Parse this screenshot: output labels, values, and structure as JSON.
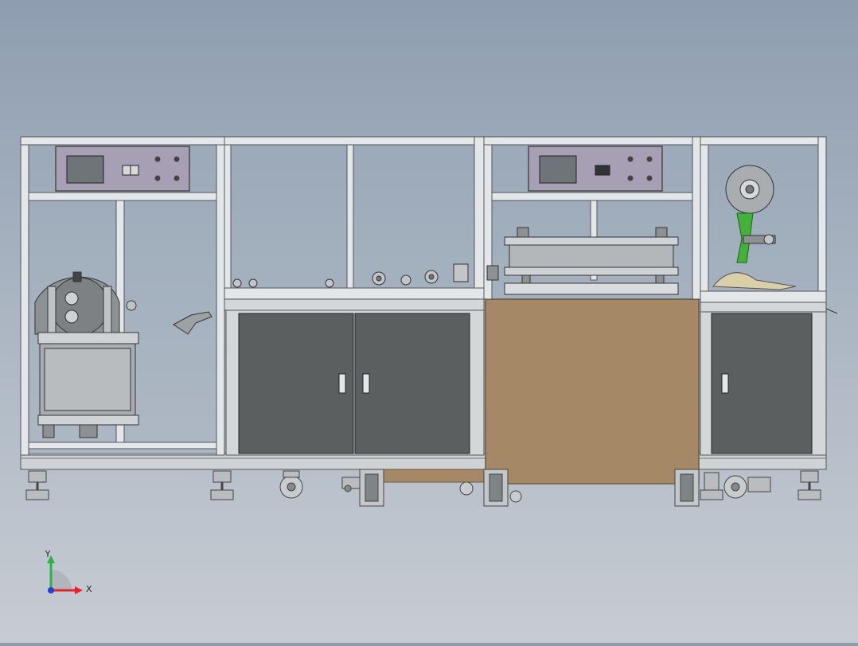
{
  "scene": {
    "background_top": "#8e9db0",
    "background_bottom": "#c7ccd3",
    "frame_color": "#dfe3e7",
    "cabinet_door_color": "#5b5f60",
    "panel_color": "#a79fb4",
    "screen_color": "#6f7478",
    "guard_color": "#a58866",
    "green_arm_color": "#43b23a"
  },
  "triad": {
    "x_label": "X",
    "y_label": "Y",
    "x_color": "#e0262b",
    "y_color": "#2bb34a",
    "z_color": "#1f3fd1"
  },
  "icons": [
    "axis-triad-icon"
  ]
}
